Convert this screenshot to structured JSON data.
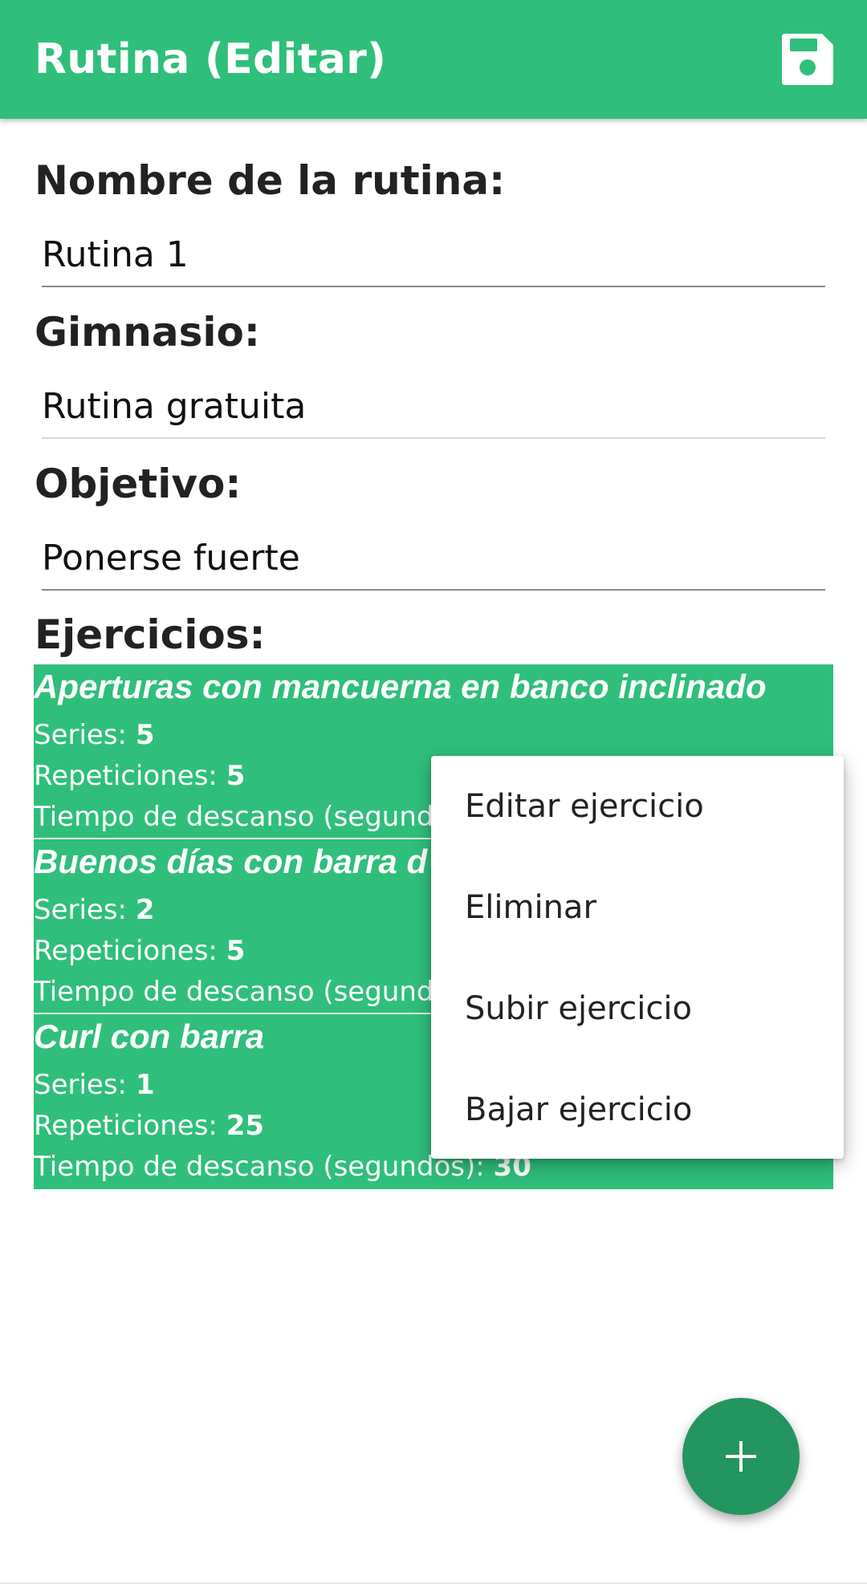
{
  "app_bar": {
    "title": "Rutina (Editar)",
    "save_icon": "floppy-disk-icon",
    "color": "#2fbf7b"
  },
  "form": {
    "routine_name_label": "Nombre de la rutina:",
    "routine_name_value": "Rutina 1",
    "gym_label": "Gimnasio:",
    "gym_value": "Rutina gratuita",
    "goal_label": "Objetivo:",
    "goal_value": "Ponerse fuerte"
  },
  "exercises_label": "Ejercicios:",
  "exercises": [
    {
      "name": "Aperturas con mancuerna en banco inclinado",
      "series_label": "Series: ",
      "series": "5",
      "reps_label": "Repeticiones: ",
      "reps": "5",
      "rest_label": "Tiempo de descanso (segundos): ",
      "rest": ""
    },
    {
      "name": "Buenos días con barra d",
      "series_label": "Series: ",
      "series": "2",
      "reps_label": "Repeticiones: ",
      "reps": "5",
      "rest_label": "Tiempo de descanso (segundos): ",
      "rest": ""
    },
    {
      "name": "Curl con barra",
      "series_label": "Series: ",
      "series": "1",
      "reps_label": "Repeticiones: ",
      "reps": "25",
      "rest_label": "Tiempo de descanso (segundos): ",
      "rest": "30"
    }
  ],
  "context_menu": {
    "items": [
      "Editar ejercicio",
      "Eliminar",
      "Subir ejercicio",
      "Bajar ejercicio"
    ]
  },
  "fab": {
    "icon": "plus-icon",
    "color": "#23955f"
  }
}
